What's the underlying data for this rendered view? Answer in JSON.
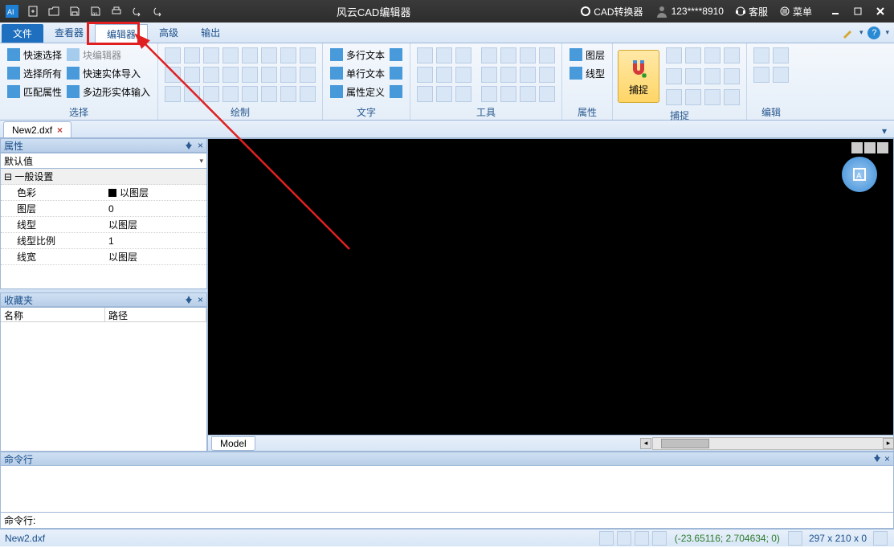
{
  "app_title": "风云CAD编辑器",
  "titlebar": {
    "cad_converter": "CAD转换器",
    "user": "123****8910",
    "support": "客服",
    "menu": "菜单"
  },
  "menutabs": {
    "file": "文件",
    "viewer": "查看器",
    "editor": "编辑器",
    "advanced": "高级",
    "output": "输出"
  },
  "ribbon": {
    "select": {
      "label": "选择",
      "quick_select": "快速选择",
      "select_all": "选择所有",
      "match_props": "匹配属性",
      "block_editor": "块编辑器",
      "quick_import": "快速实体导入",
      "poly_select": "多边形实体输入"
    },
    "draw": {
      "label": "绘制"
    },
    "text": {
      "label": "文字",
      "mtext": "多行文本",
      "stext": "单行文本",
      "attdef": "属性定义"
    },
    "tools": {
      "label": "工具"
    },
    "layers": {
      "label": "属性",
      "layer": "图层",
      "linetype": "线型"
    },
    "snap": {
      "label": "捕捉",
      "button": "捕捉"
    },
    "edit": {
      "label": "编辑"
    }
  },
  "file_tab": "New2.dxf",
  "props": {
    "title": "属性",
    "default": "默认值",
    "general": "一般设置",
    "rows": [
      {
        "k": "色彩",
        "v": "以图层",
        "swatch": true
      },
      {
        "k": "图层",
        "v": "0"
      },
      {
        "k": "线型",
        "v": "以图层"
      },
      {
        "k": "线型比例",
        "v": "1"
      },
      {
        "k": "线宽",
        "v": "以图层"
      }
    ]
  },
  "fav": {
    "title": "收藏夹",
    "col1": "名称",
    "col2": "路径"
  },
  "model_tab": "Model",
  "cmd": {
    "title": "命令行",
    "prompt": "命令行:"
  },
  "status": {
    "file": "New2.dxf",
    "coords": "(-23.65116; 2.704634; 0)",
    "dims": "297 x 210 x 0"
  }
}
